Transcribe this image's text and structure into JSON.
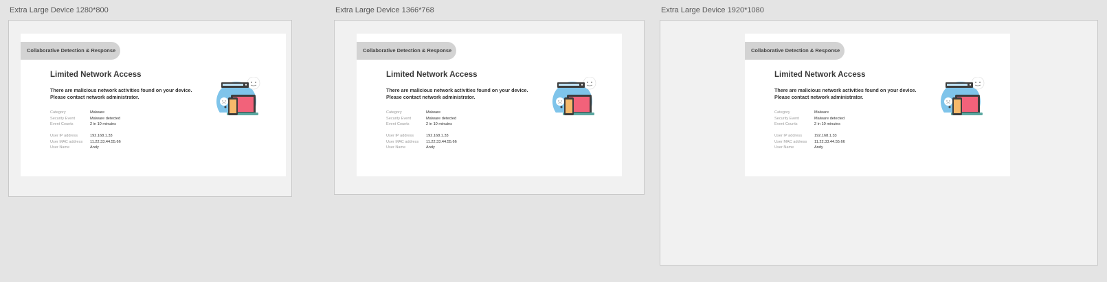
{
  "artboards": [
    {
      "label": "Extra Large Device 1280*800",
      "card": {
        "badge": "Collaborative Detection & Response",
        "title": "Limited Network Access",
        "message_line1": "There are malicious network activities found on your device.",
        "message_line2": "Please contact network administrator.",
        "event_info": [
          {
            "key": "Category",
            "value": "Malware"
          },
          {
            "key": "Security Event",
            "value": "Malware detected"
          },
          {
            "key": "Event Counts",
            "value": "2 in 10 minutes"
          }
        ],
        "user_info": [
          {
            "key": "User IP address",
            "value": "192.168.1.33"
          },
          {
            "key": "User MAC address",
            "value": "11.22.33.44.55.66"
          },
          {
            "key": "User Name",
            "value": "Andy"
          }
        ]
      }
    },
    {
      "label": "Extra Large Device 1366*768",
      "card": {
        "badge": "Collaborative Detection & Response",
        "title": "Limited Network Access",
        "message_line1": "There are malicious network activities found on your device.",
        "message_line2": "Please contact network administrator.",
        "event_info": [
          {
            "key": "Category",
            "value": "Malware"
          },
          {
            "key": "Security Event",
            "value": "Malware detected"
          },
          {
            "key": "Event Counts",
            "value": "2 in 10 minutes"
          }
        ],
        "user_info": [
          {
            "key": "User IP address",
            "value": "192.168.1.33"
          },
          {
            "key": "User MAC address",
            "value": "11.22.33.44.55.66"
          },
          {
            "key": "User Name",
            "value": "Andy"
          }
        ]
      }
    },
    {
      "label": "Extra Large Device 1920*1080",
      "card": {
        "badge": "Collaborative Detection & Response",
        "title": "Limited Network Access",
        "message_line1": "There are malicious network activities found on your device.",
        "message_line2": "Please contact network administrator.",
        "event_info": [
          {
            "key": "Category",
            "value": "Malware"
          },
          {
            "key": "Security Event",
            "value": "Malware detected"
          },
          {
            "key": "Event Counts",
            "value": "2 in 10 minutes"
          }
        ],
        "user_info": [
          {
            "key": "User IP address",
            "value": "192.168.1.33"
          },
          {
            "key": "User MAC address",
            "value": "11.22.33.44.55.66"
          },
          {
            "key": "User Name",
            "value": "Andy"
          }
        ]
      }
    }
  ],
  "illustration": {
    "icon": "devices-illustration",
    "colors": {
      "circle": "#7fc4ea",
      "laptop": "#f2627a",
      "phone": "#f6b96b",
      "dark": "#3d3d3d",
      "teal": "#5aa7a0"
    }
  }
}
